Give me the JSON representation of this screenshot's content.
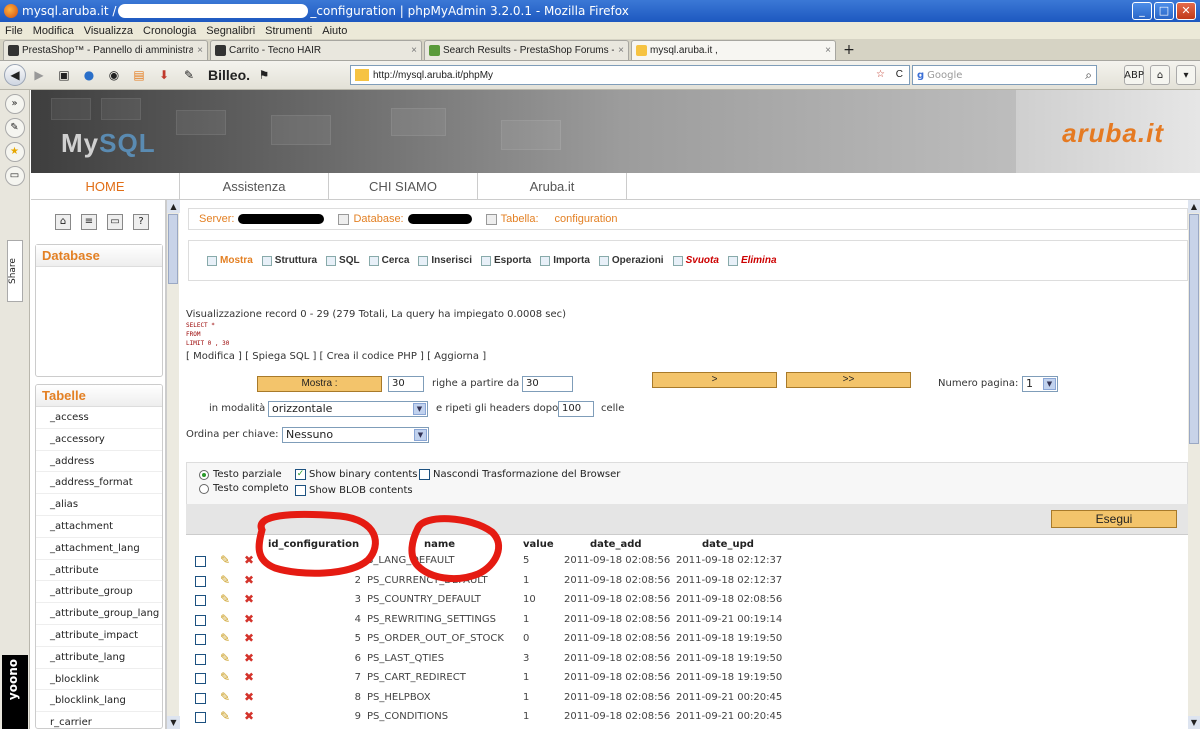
{
  "window": {
    "title_prefix": "mysql.aruba.it /",
    "title_suffix": "_configuration | phpMyAdmin 3.2.0.1 - Mozilla Firefox",
    "min": "_",
    "max": "□",
    "close": "✕"
  },
  "menu": [
    "File",
    "Modifica",
    "Visualizza",
    "Cronologia",
    "Segnalibri",
    "Strumenti",
    "Aiuto"
  ],
  "tabs": [
    {
      "label": "PrestaShop™ - Pannello di amministrazione",
      "close": "×"
    },
    {
      "label": "Carrito - Tecno HAIR",
      "close": "×"
    },
    {
      "label": "Search Results - PrestaShop Forums - Pa...",
      "close": "×"
    },
    {
      "label": "mysql.aruba.it ,",
      "close": "×"
    }
  ],
  "newtab": "+",
  "nav": {
    "billeo": "Billeo.",
    "url": "http://mysql.aruba.it/phpMy",
    "search_placeholder": "Google"
  },
  "sidebar": {
    "share": "Share",
    "yoono": "yoono"
  },
  "header": {
    "mysql_logo_a": "My",
    "mysql_logo_b": "SQL",
    "aruba_logo": "aruba.it"
  },
  "topnav": [
    "HOME",
    "Assistenza",
    "CHI SIAMO",
    "Aruba.it"
  ],
  "left": {
    "database_title": "Database",
    "tables_title": "Tabelle",
    "tables": [
      "_access",
      "_accessory",
      "_address",
      "_address_format",
      "_alias",
      "_attachment",
      "_attachment_lang",
      "_attribute",
      "_attribute_group",
      "_attribute_group_lang",
      "_attribute_impact",
      "_attribute_lang",
      "_blocklink",
      "_blocklink_lang",
      "r_carrier"
    ]
  },
  "breadcrumb": {
    "server": "Server:",
    "database": "Database:",
    "table": "Tabella:",
    "table_name": "configuration"
  },
  "actions": [
    {
      "label": "Mostra",
      "kind": "cur"
    },
    {
      "label": "Struttura",
      "kind": ""
    },
    {
      "label": "SQL",
      "kind": ""
    },
    {
      "label": "Cerca",
      "kind": ""
    },
    {
      "label": "Inserisci",
      "kind": ""
    },
    {
      "label": "Esporta",
      "kind": ""
    },
    {
      "label": "Importa",
      "kind": ""
    },
    {
      "label": "Operazioni",
      "kind": ""
    },
    {
      "label": "Svuota",
      "kind": "danger"
    },
    {
      "label": "Elimina",
      "kind": "danger"
    }
  ],
  "info": {
    "records": "Visualizzazione record 0 - 29 (279 Totali, La query ha impiegato 0.0008 sec)",
    "sql_select": "SELECT *",
    "sql_from": "FROM",
    "sql_limit": "LIMIT 0 , 30",
    "links": "[ Modifica ] [ Spiega SQL ] [ Crea il codice PHP ] [ Aggiorna ]"
  },
  "controls": {
    "show_button": "Mostra :",
    "rows": "30",
    "rows_label": "righe a partire da",
    "start": "30",
    "next": ">",
    "last": ">>",
    "page_label": "Numero pagina:",
    "page": "1",
    "mode_label": "in modalità",
    "mode": "orizzontale",
    "repeat_label": "e ripeti gli headers dopo",
    "repeat": "100",
    "cells_label": "celle",
    "sort_label": "Ordina per chiave:",
    "sort": "Nessuno"
  },
  "options": {
    "partial": "Testo parziale",
    "full": "Testo completo",
    "binary": "Show binary contents",
    "blob": "Show BLOB contents",
    "hide": "Nascondi Trasformazione del Browser",
    "execute": "Esegui"
  },
  "columns": [
    "id_configuration",
    "name",
    "value",
    "date_add",
    "date_upd"
  ],
  "rows": [
    {
      "id": "",
      "name": "S_LANG_DEFAULT",
      "value": "5",
      "date_add": "2011-09-18 02:08:56",
      "date_upd": "2011-09-18 02:12:37"
    },
    {
      "id": "2",
      "name": "PS_CURRENCY_DEFAULT",
      "value": "1",
      "date_add": "2011-09-18 02:08:56",
      "date_upd": "2011-09-18 02:12:37"
    },
    {
      "id": "3",
      "name": "PS_COUNTRY_DEFAULT",
      "value": "10",
      "date_add": "2011-09-18 02:08:56",
      "date_upd": "2011-09-18 02:08:56"
    },
    {
      "id": "4",
      "name": "PS_REWRITING_SETTINGS",
      "value": "1",
      "date_add": "2011-09-18 02:08:56",
      "date_upd": "2011-09-21 00:19:14"
    },
    {
      "id": "5",
      "name": "PS_ORDER_OUT_OF_STOCK",
      "value": "0",
      "date_add": "2011-09-18 02:08:56",
      "date_upd": "2011-09-18 19:19:50"
    },
    {
      "id": "6",
      "name": "PS_LAST_QTIES",
      "value": "3",
      "date_add": "2011-09-18 02:08:56",
      "date_upd": "2011-09-18 19:19:50"
    },
    {
      "id": "7",
      "name": "PS_CART_REDIRECT",
      "value": "1",
      "date_add": "2011-09-18 02:08:56",
      "date_upd": "2011-09-18 19:19:50"
    },
    {
      "id": "8",
      "name": "PS_HELPBOX",
      "value": "1",
      "date_add": "2011-09-18 02:08:56",
      "date_upd": "2011-09-21 00:20:45"
    },
    {
      "id": "9",
      "name": "PS_CONDITIONS",
      "value": "1",
      "date_add": "2011-09-18 02:08:56",
      "date_upd": "2011-09-21 00:20:45"
    }
  ],
  "row_icons": {
    "edit": "✎",
    "delete": "✖"
  }
}
